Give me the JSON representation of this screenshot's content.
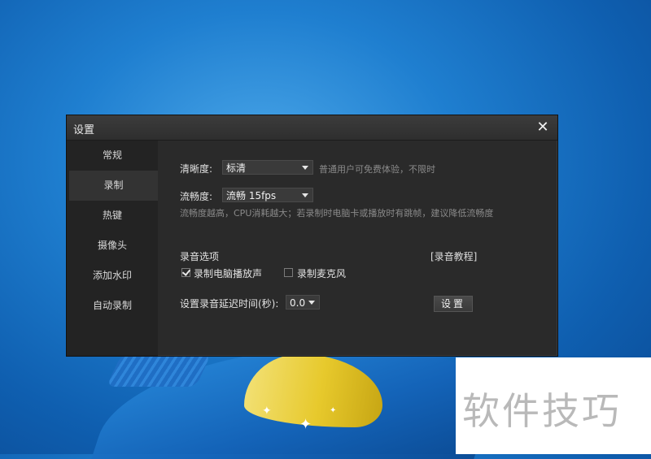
{
  "dialog": {
    "title": "设置",
    "close_label": "✕"
  },
  "sidebar": {
    "items": [
      {
        "label": "常规"
      },
      {
        "label": "录制"
      },
      {
        "label": "热键"
      },
      {
        "label": "摄像头"
      },
      {
        "label": "添加水印"
      },
      {
        "label": "自动录制"
      }
    ],
    "active_index": 1
  },
  "record": {
    "clarity_label": "清晰度:",
    "clarity_value": "标清",
    "clarity_hint": "普通用户可免费体验，不限时",
    "fluency_label": "流畅度:",
    "fluency_value": "流畅 15fps",
    "fluency_hint": "流畅度越高，CPU消耗越大；若录制时电脑卡或播放时有跳帧，建议降低流畅度",
    "audio_section_label": "录音选项",
    "tutorial_link": "[录音教程]",
    "record_pc_sound_label": "录制电脑播放声",
    "record_pc_sound_checked": true,
    "record_mic_label": "录制麦克风",
    "record_mic_checked": false,
    "delay_label": "设置录音延迟时间(秒):",
    "delay_value": "0.0",
    "settings_button": "设置"
  },
  "watermark_text": "软件技巧"
}
